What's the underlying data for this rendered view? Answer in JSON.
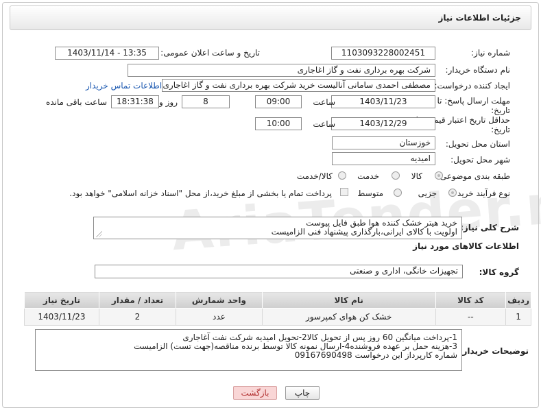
{
  "header": {
    "title": "جزئیات اطلاعات نیاز"
  },
  "watermark": "AriaTender.net",
  "fields": {
    "need_number": {
      "label": "شماره نیاز:",
      "value": "1103093228002451"
    },
    "announce_datetime": {
      "label": "تاریخ و ساعت اعلان عمومی:",
      "value": "1403/11/14 - 13:35"
    },
    "buyer_org": {
      "label": "نام دستگاه خریدار:",
      "value": "شرکت بهره برداری نفت و گاز اغاجاری"
    },
    "requester": {
      "label": "ایجاد کننده درخواست:",
      "value": "مصطفی احمدی سامانی آنالیست خرید شرکت بهره برداری نفت و گاز اغاجاری",
      "contact_link": "اطلاعات تماس خریدار"
    },
    "reply_deadline": {
      "label_line1": "مهلت ارسال پاسخ: تا",
      "label_line2": "تاریخ:",
      "date": "1403/11/23",
      "time_label": "ساعت",
      "time": "09:00",
      "days": "8",
      "days_label": "روز و",
      "remaining": "18:31:38",
      "remaining_label": "ساعت باقی مانده"
    },
    "price_validity": {
      "label_line1": "حداقل تاریخ اعتبار قیمت: تا",
      "label_line2": "تاریخ:",
      "date": "1403/12/29",
      "time_label": "ساعت",
      "time": "10:00"
    },
    "province": {
      "label": "استان محل تحویل:",
      "value": "خوزستان"
    },
    "city": {
      "label": "شهر محل تحویل:",
      "value": "امیدیه"
    },
    "category": {
      "label": "طبقه بندی موضوعی:",
      "options": [
        "کالا",
        "خدمت",
        "کالا/خدمت"
      ],
      "selected": "کالا"
    },
    "purchase_process": {
      "label": "نوع فرآیند خرید :",
      "options": [
        "جزیی",
        "متوسط"
      ],
      "selected": "جزیی",
      "note": "پرداخت تمام یا بخشی از مبلغ خرید،از محل \"اسناد خزانه اسلامی\" خواهد بود."
    }
  },
  "summary": {
    "label": "شرح کلی نیاز:",
    "lines": [
      "خرید هیتر خشک کننده هوا طبق فایل پیوست",
      "اولویت با کالای ایرانی،بارگذاری پیشنهاد فنی الزامیست"
    ]
  },
  "goods_section": {
    "title": "اطلاعات کالاهای مورد نیاز",
    "group_label": "گروه کالا:",
    "group_value": "تجهیزات خانگی، اداری و صنعتی"
  },
  "items_table": {
    "columns": [
      "ردیف",
      "کد کالا",
      "نام کالا",
      "واحد شمارش",
      "تعداد / مقدار",
      "تاریخ نیاز"
    ],
    "rows": [
      [
        "1",
        "--",
        "خشک کن هوای کمپرسور",
        "عدد",
        "2",
        "1403/11/23"
      ]
    ]
  },
  "buyer_notes": {
    "label": "توضیحات خریدار:",
    "lines": [
      "1-پرداخت میانگین 60 روز پس از تحویل کالا2-تحویل امیدیه شرکت نفت آغاجاری",
      "3-هزینه حمل بر عهده فروشنده4-ارسال نمونه کالا توسط برنده مناقصه(جهت تست) الزامیست",
      "شماره کارپرداز این درخواست 09167690498"
    ]
  },
  "buttons": {
    "print": "چاپ",
    "back": "بازگشت"
  },
  "colors": {
    "link": "#1a57b0",
    "back_button_bg": "#f9d6d6",
    "back_button_text": "#b33333"
  }
}
